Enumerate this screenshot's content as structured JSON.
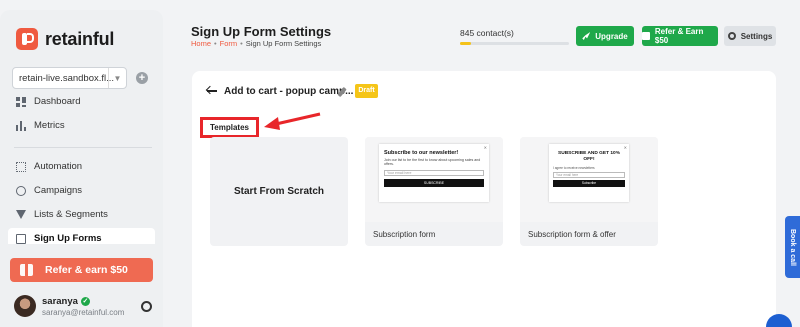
{
  "brand": {
    "name": "retainful"
  },
  "sidebar": {
    "store": "retain-live.sandbox.fl...",
    "items": [
      {
        "label": "Dashboard",
        "icon": "dashboard-icon"
      },
      {
        "label": "Metrics",
        "icon": "metrics-icon"
      },
      {
        "label": "Automation",
        "icon": "automation-icon"
      },
      {
        "label": "Campaigns",
        "icon": "campaigns-icon"
      },
      {
        "label": "Lists & Segments",
        "icon": "filter-icon"
      },
      {
        "label": "Sign Up Forms",
        "icon": "form-icon"
      }
    ],
    "refer_label": "Refer & earn $50",
    "user": {
      "name": "saranya",
      "email": "saranya@retainful.com"
    }
  },
  "header": {
    "title": "Sign Up Form Settings",
    "breadcrumb": [
      "Home",
      "Form",
      "Sign Up Form Settings"
    ],
    "contacts": "845 contact(s)",
    "contacts_progress": 0.1,
    "upgrade_label": "Upgrade",
    "refer_label": "Refer & Earn $50",
    "settings_label": "Settings"
  },
  "main": {
    "campaign_title": "Add to cart - popup camp...",
    "status": "Draft",
    "section_label": "Templates",
    "scratch_label": "Start From Scratch",
    "templates": [
      {
        "label": "Subscription form",
        "preview": {
          "heading": "Subscribe to our newsletter!",
          "text": "Join our list to be the first to know about upcoming sales and offers.",
          "placeholder": "Your email here",
          "button": "SUBSCRIBE"
        }
      },
      {
        "label": "Subscription form & offer",
        "preview": {
          "heading": "SUBSCRIBE AND GET 10% OFF!",
          "checkbox": "I agree to receive newsletters",
          "placeholder": "Your email here",
          "button": "Subscribe"
        }
      }
    ]
  },
  "widgets": {
    "book_call": "Book a call"
  },
  "colors": {
    "brand": "#ef5a40",
    "green": "#1fa84a",
    "draft": "#f5c518",
    "annotation": "#e8262a",
    "progress": "#f4c21a"
  }
}
